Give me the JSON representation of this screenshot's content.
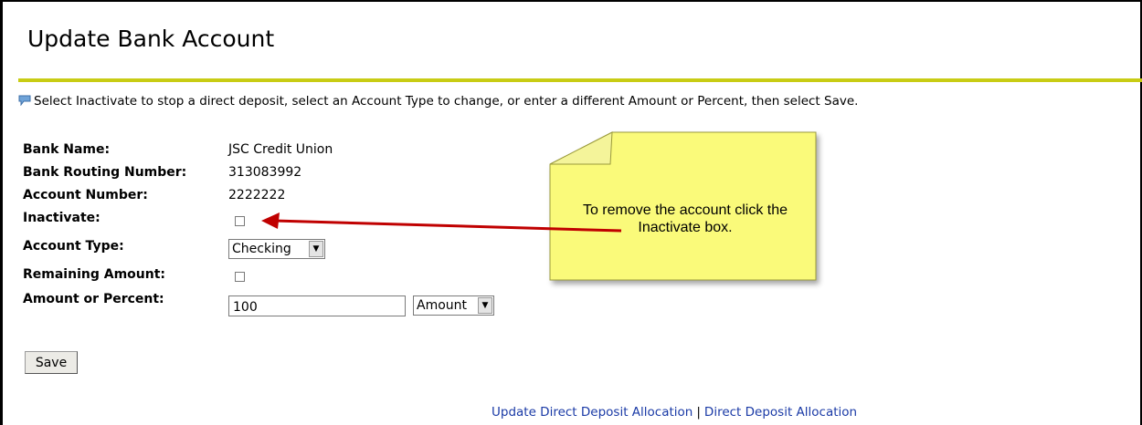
{
  "page": {
    "title": "Update Bank Account",
    "instruction": "Select Inactivate to stop a direct deposit, select an Account Type to change, or enter a different Amount or Percent, then select Save."
  },
  "colors": {
    "title_rule": "#c8cc14",
    "link": "#1a3aa6",
    "note_fill": "#fafa7a",
    "arrow": "#c00000"
  },
  "icons": {
    "instruction": "flag-icon"
  },
  "fields": {
    "bank_name": {
      "label": "Bank Name:",
      "value": "JSC Credit Union"
    },
    "routing": {
      "label": "Bank Routing Number:",
      "value": "313083992"
    },
    "account_number": {
      "label": "Account Number:",
      "value": "2222222"
    },
    "inactivate": {
      "label": "Inactivate:",
      "checked": false
    },
    "account_type": {
      "label": "Account Type:",
      "selected": "Checking"
    },
    "remaining": {
      "label": "Remaining Amount:",
      "checked": false
    },
    "amount": {
      "label": "Amount or Percent:",
      "value": "100",
      "unit_selected": "Amount"
    }
  },
  "buttons": {
    "save": "Save"
  },
  "callout": {
    "text": "To remove the account click the Inactivate box."
  },
  "footer": {
    "link1": "Update Direct Deposit Allocation",
    "separator": "|",
    "link2": "Direct Deposit Allocation"
  }
}
